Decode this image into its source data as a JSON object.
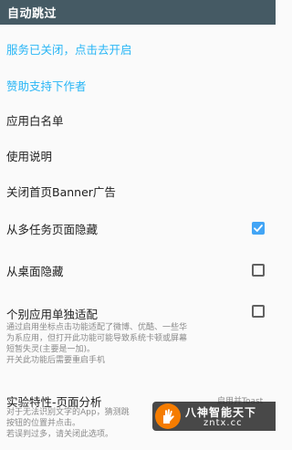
{
  "appbar": {
    "title": "自动跳过"
  },
  "items": {
    "service": "服务已关闭，点击去开启",
    "donate": "赞助支持下作者",
    "whitelist": "应用白名单",
    "usage": "使用说明",
    "close_banner": "关闭首页Banner广告",
    "hide_recents": "从多任务页面隐藏",
    "hide_launcher": "从桌面隐藏",
    "per_app": "个别应用单独适配",
    "per_app_desc": [
      "通过启用坐标点击功能适配了微博、优酷、一些华",
      "为系应用，但打开此功能可能导致系统卡顿或屏幕",
      "短暂失灵(主要是一加)。",
      "开关此功能后需要重启手机"
    ],
    "experimental": "实验特性-页面分析",
    "experimental_note": "启用并Toast",
    "experimental_desc": [
      "对于无法识别文字的App，猜测跳",
      "按钮的位置并点击。",
      "若误判过多，请关闭此选项。"
    ]
  },
  "settings": {
    "hide_recents": true,
    "hide_launcher": false,
    "per_app": false
  },
  "watermark": {
    "title": "八神智能天下",
    "url": "zntx.cc"
  },
  "colors": {
    "appbar": "#455a64",
    "link": "#29b6f6",
    "checkbox_checked": "#42a5f5"
  }
}
